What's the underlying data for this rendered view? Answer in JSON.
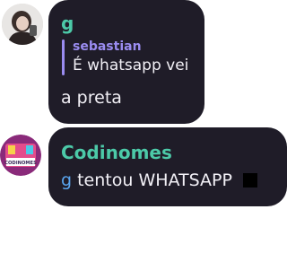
{
  "messages": [
    {
      "author": "g",
      "reply": {
        "author": "sebastian",
        "text": "É whatsapp vei"
      },
      "text": "a preta"
    },
    {
      "author": "Codinomes",
      "avatar_label": "CODINOMES",
      "mention": "g",
      "text": "tentou WHATSAPP",
      "emoji": "black-square"
    }
  ],
  "colors": {
    "bubble": "#1f1c28",
    "author": "#4cc9a8",
    "reply": "#9a8cf0",
    "mention": "#5aa6f0",
    "text": "#f2f0f6"
  }
}
